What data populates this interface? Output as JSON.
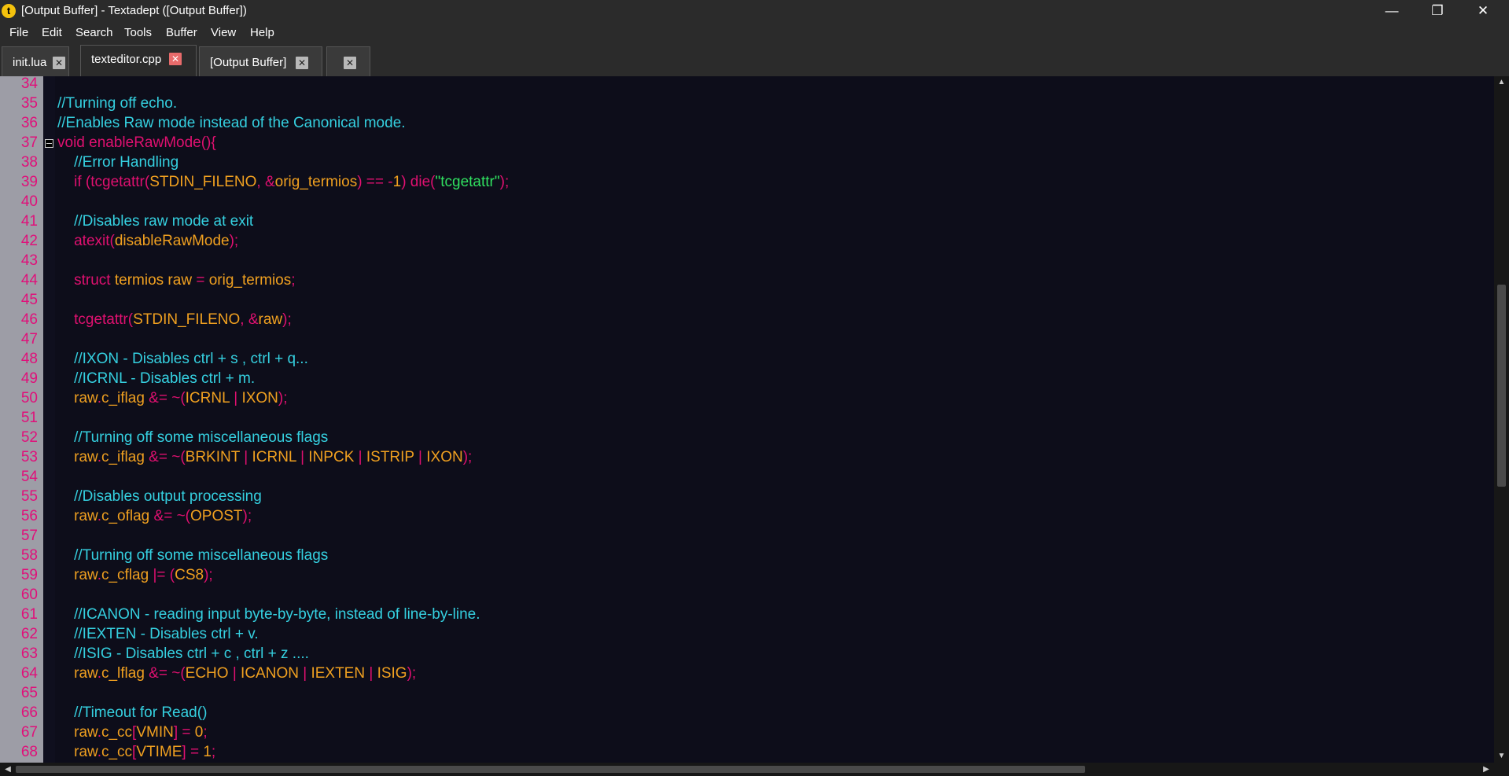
{
  "window": {
    "title": "[Output Buffer] - Textadept ([Output Buffer])",
    "app_icon_glyph": "t",
    "minimize_glyph": "—",
    "restore_glyph": "❐",
    "close_glyph": "✕"
  },
  "menu": [
    "File",
    "Edit",
    "Search",
    "Tools",
    "Buffer",
    "View",
    "Help"
  ],
  "tabs": [
    {
      "label": "init.lua",
      "active": false
    },
    {
      "label": "texteditor.cpp",
      "active": true
    },
    {
      "label": "[Output Buffer]",
      "active": false
    },
    {
      "label": "",
      "active": false
    }
  ],
  "tab_close_glyph": "✕",
  "editor": {
    "line_numbers": [
      "34",
      "35",
      "36",
      "37",
      "38",
      "39",
      "40",
      "41",
      "42",
      "43",
      "44",
      "45",
      "46",
      "47",
      "48",
      "49",
      "50",
      "51",
      "52",
      "53",
      "54",
      "55",
      "56",
      "57",
      "58",
      "59",
      "60",
      "61",
      "62",
      "63",
      "64",
      "65",
      "66",
      "67",
      "68"
    ],
    "fold_line": "37",
    "lines": [
      [],
      [
        [
          "comment",
          "//Turning off echo."
        ]
      ],
      [
        [
          "comment",
          "//Enables Raw mode instead of the Canonical mode."
        ]
      ],
      [
        [
          "kw",
          "void enableRawMode(){"
        ]
      ],
      [
        [
          "comment",
          "    //Error Handling"
        ]
      ],
      [
        [
          "kw",
          "    if ("
        ],
        [
          "kw",
          "tcgetattr("
        ],
        [
          "id",
          "STDIN_FILENO"
        ],
        [
          "op",
          ", &"
        ],
        [
          "id",
          "orig_termios"
        ],
        [
          "op",
          ") == -"
        ],
        [
          "num",
          "1"
        ],
        [
          "op",
          ") "
        ],
        [
          "kw",
          "die("
        ],
        [
          "str",
          "\"tcgetattr\""
        ],
        [
          "op",
          ");"
        ]
      ],
      [],
      [
        [
          "comment",
          "    //Disables raw mode at exit"
        ]
      ],
      [
        [
          "kw",
          "    atexit("
        ],
        [
          "id",
          "disableRawMode"
        ],
        [
          "op",
          ");"
        ]
      ],
      [],
      [
        [
          "kw",
          "    struct "
        ],
        [
          "id",
          "termios raw"
        ],
        [
          "op",
          " = "
        ],
        [
          "id",
          "orig_termios"
        ],
        [
          "op",
          ";"
        ]
      ],
      [],
      [
        [
          "kw",
          "    tcgetattr("
        ],
        [
          "id",
          "STDIN_FILENO"
        ],
        [
          "op",
          ", &"
        ],
        [
          "id",
          "raw"
        ],
        [
          "op",
          ");"
        ]
      ],
      [],
      [
        [
          "comment",
          "    //IXON - Disables ctrl + s , ctrl + q..."
        ]
      ],
      [
        [
          "comment",
          "    //ICRNL - Disables ctrl + m."
        ]
      ],
      [
        [
          "id",
          "    raw"
        ],
        [
          "op",
          "."
        ],
        [
          "id",
          "c_iflag"
        ],
        [
          "op",
          " &= ~("
        ],
        [
          "id",
          "ICRNL"
        ],
        [
          "op",
          " | "
        ],
        [
          "id",
          "IXON"
        ],
        [
          "op",
          ");"
        ]
      ],
      [],
      [
        [
          "comment",
          "    //Turning off some miscellaneous flags"
        ]
      ],
      [
        [
          "id",
          "    raw"
        ],
        [
          "op",
          "."
        ],
        [
          "id",
          "c_iflag"
        ],
        [
          "op",
          " &= ~("
        ],
        [
          "id",
          "BRKINT"
        ],
        [
          "op",
          " | "
        ],
        [
          "id",
          "ICRNL"
        ],
        [
          "op",
          " | "
        ],
        [
          "id",
          "INPCK"
        ],
        [
          "op",
          " | "
        ],
        [
          "id",
          "ISTRIP"
        ],
        [
          "op",
          " | "
        ],
        [
          "id",
          "IXON"
        ],
        [
          "op",
          ");"
        ]
      ],
      [],
      [
        [
          "comment",
          "    //Disables output processing"
        ]
      ],
      [
        [
          "id",
          "    raw"
        ],
        [
          "op",
          "."
        ],
        [
          "id",
          "c_oflag"
        ],
        [
          "op",
          " &= ~("
        ],
        [
          "id",
          "OPOST"
        ],
        [
          "op",
          ");"
        ]
      ],
      [],
      [
        [
          "comment",
          "    //Turning off some miscellaneous flags"
        ]
      ],
      [
        [
          "id",
          "    raw"
        ],
        [
          "op",
          "."
        ],
        [
          "id",
          "c_cflag"
        ],
        [
          "op",
          " |= ("
        ],
        [
          "id",
          "CS8"
        ],
        [
          "op",
          ");"
        ]
      ],
      [],
      [
        [
          "comment",
          "    //ICANON - reading input byte-by-byte, instead of line-by-line."
        ]
      ],
      [
        [
          "comment",
          "    //IEXTEN - Disables ctrl + v."
        ]
      ],
      [
        [
          "comment",
          "    //ISIG - Disables ctrl + c , ctrl + z ...."
        ]
      ],
      [
        [
          "id",
          "    raw"
        ],
        [
          "op",
          "."
        ],
        [
          "id",
          "c_lflag"
        ],
        [
          "op",
          " &= ~("
        ],
        [
          "id",
          "ECHO"
        ],
        [
          "op",
          " | "
        ],
        [
          "id",
          "ICANON"
        ],
        [
          "op",
          " | "
        ],
        [
          "id",
          "IEXTEN"
        ],
        [
          "op",
          " | "
        ],
        [
          "id",
          "ISIG"
        ],
        [
          "op",
          ");"
        ]
      ],
      [],
      [
        [
          "comment",
          "    //Timeout for Read()"
        ]
      ],
      [
        [
          "id",
          "    raw"
        ],
        [
          "op",
          "."
        ],
        [
          "id",
          "c_cc"
        ],
        [
          "op",
          "["
        ],
        [
          "id",
          "VMIN"
        ],
        [
          "op",
          "] = "
        ],
        [
          "num",
          "0"
        ],
        [
          "op",
          ";"
        ]
      ],
      [
        [
          "id",
          "    raw"
        ],
        [
          "op",
          "."
        ],
        [
          "id",
          "c_cc"
        ],
        [
          "op",
          "["
        ],
        [
          "id",
          "VTIME"
        ],
        [
          "op",
          "] = "
        ],
        [
          "num",
          "1"
        ],
        [
          "op",
          ";"
        ]
      ]
    ]
  },
  "scrollbars": {
    "up_glyph": "▲",
    "down_glyph": "▼",
    "left_glyph": "◀",
    "right_glyph": "▶"
  }
}
